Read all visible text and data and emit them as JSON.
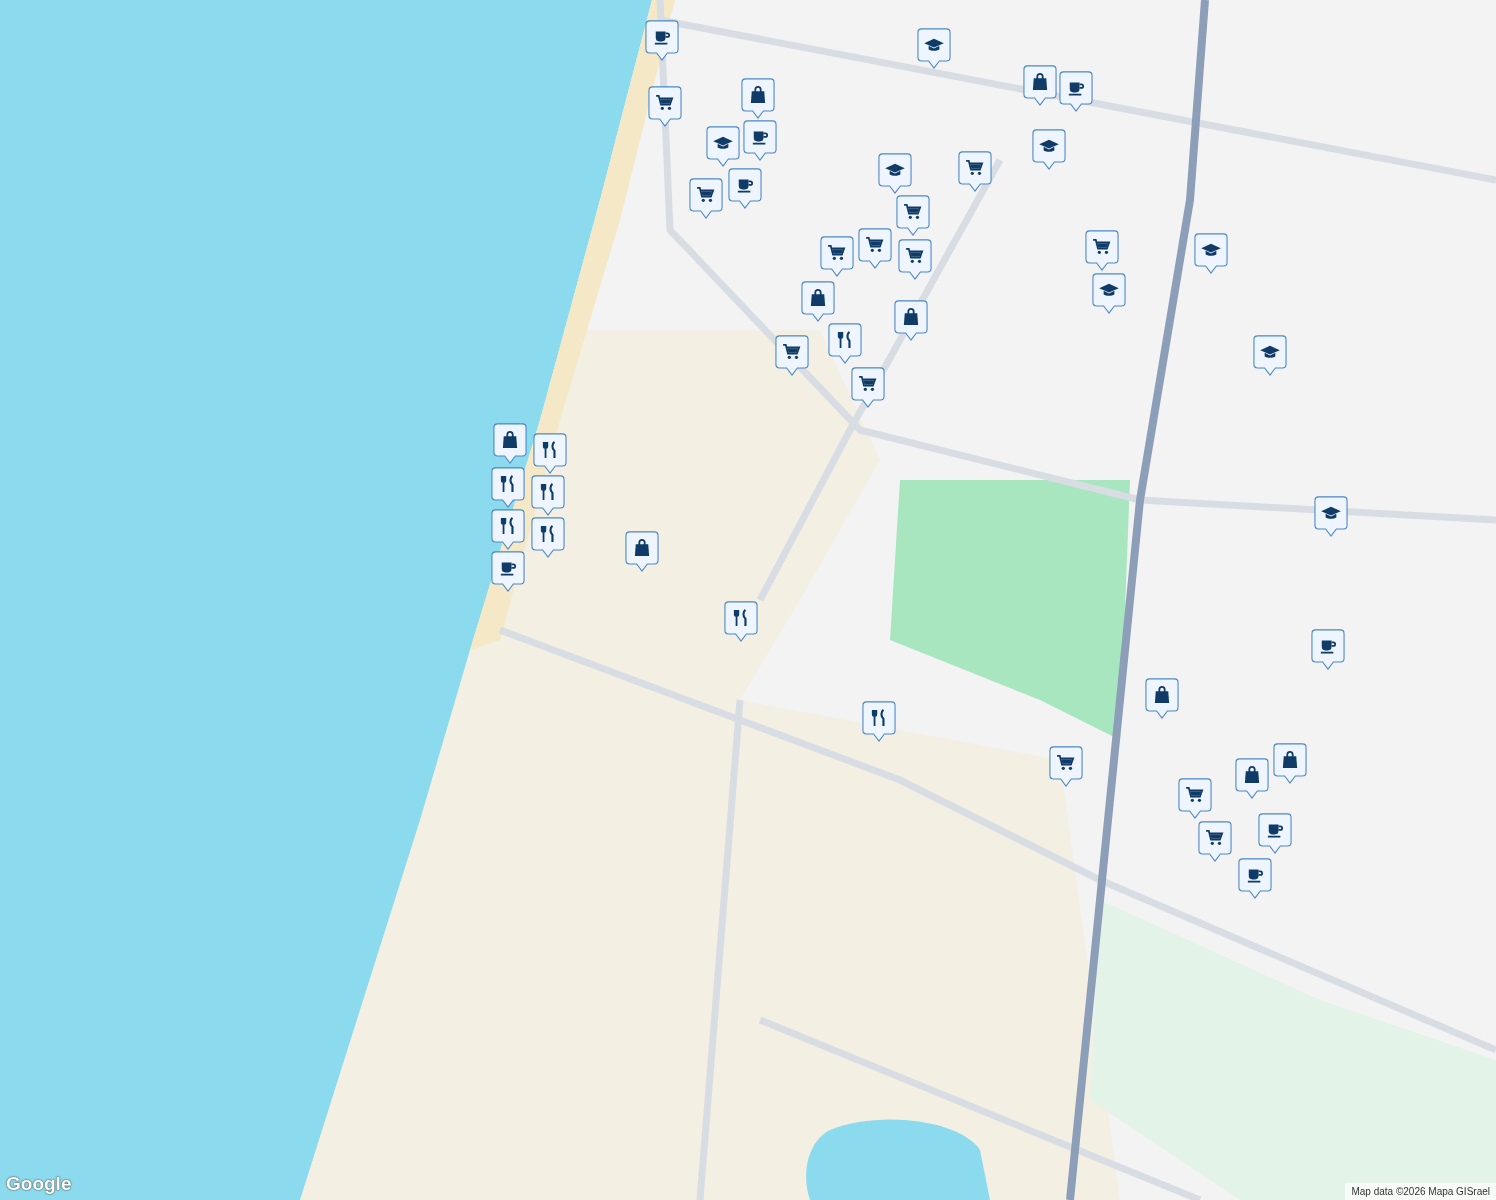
{
  "map": {
    "markers": [
      {
        "kind": "cup"
      },
      {
        "kind": "mortarboard"
      },
      {
        "kind": "cart"
      },
      {
        "kind": "bag"
      },
      {
        "kind": "cup"
      },
      {
        "kind": "mortarboard"
      },
      {
        "kind": "cup"
      },
      {
        "kind": "cart"
      },
      {
        "kind": "bag"
      },
      {
        "kind": "cup"
      },
      {
        "kind": "mortarboard"
      },
      {
        "kind": "mortarboard"
      },
      {
        "kind": "cart"
      },
      {
        "kind": "cart"
      },
      {
        "kind": "cart"
      },
      {
        "kind": "cart"
      },
      {
        "kind": "cart"
      },
      {
        "kind": "cart"
      },
      {
        "kind": "mortarboard"
      },
      {
        "kind": "mortarboard"
      },
      {
        "kind": "bag"
      },
      {
        "kind": "fork-knife"
      },
      {
        "kind": "bag"
      },
      {
        "kind": "cart"
      },
      {
        "kind": "cart"
      },
      {
        "kind": "mortarboard"
      },
      {
        "kind": "bag"
      },
      {
        "kind": "fork-knife"
      },
      {
        "kind": "fork-knife"
      },
      {
        "kind": "fork-knife"
      },
      {
        "kind": "fork-knife"
      },
      {
        "kind": "fork-knife"
      },
      {
        "kind": "cup"
      },
      {
        "kind": "bag"
      },
      {
        "kind": "fork-knife"
      },
      {
        "kind": "fork-knife"
      },
      {
        "kind": "mortarboard"
      },
      {
        "kind": "cup"
      },
      {
        "kind": "bag"
      },
      {
        "kind": "cart"
      },
      {
        "kind": "bag"
      },
      {
        "kind": "bag"
      },
      {
        "kind": "cart"
      },
      {
        "kind": "cart"
      },
      {
        "kind": "cup"
      },
      {
        "kind": "cup"
      }
    ]
  },
  "logo": "Google",
  "attribution": "Map data ©2026 Mapa GISrael"
}
